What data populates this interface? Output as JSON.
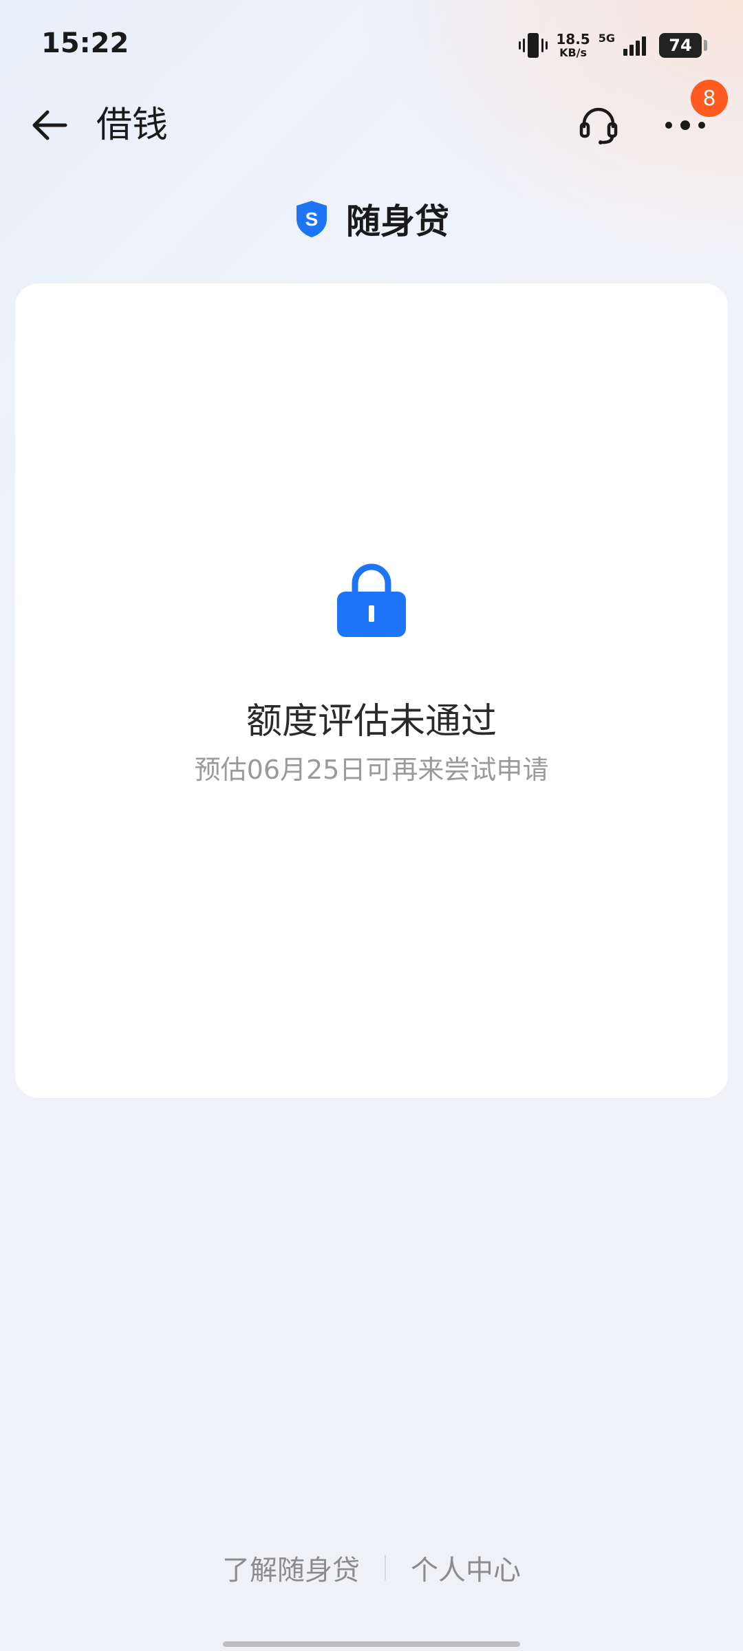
{
  "status_bar": {
    "time": "15:22",
    "net_speed_value": "18.5",
    "net_speed_unit": "KB/s",
    "network_type": "5G",
    "battery": "74"
  },
  "nav": {
    "title": "借钱",
    "badge_count": "8"
  },
  "product": {
    "logo_letter": "S",
    "name": "随身贷"
  },
  "card": {
    "title": "额度评估未通过",
    "subtitle": "预估06月25日可再来尝试申请"
  },
  "bottom_links": {
    "learn_more": "了解随身贷",
    "personal_center": "个人中心"
  },
  "colors": {
    "accent": "#1e74f6",
    "badge": "#ff5a1f"
  }
}
